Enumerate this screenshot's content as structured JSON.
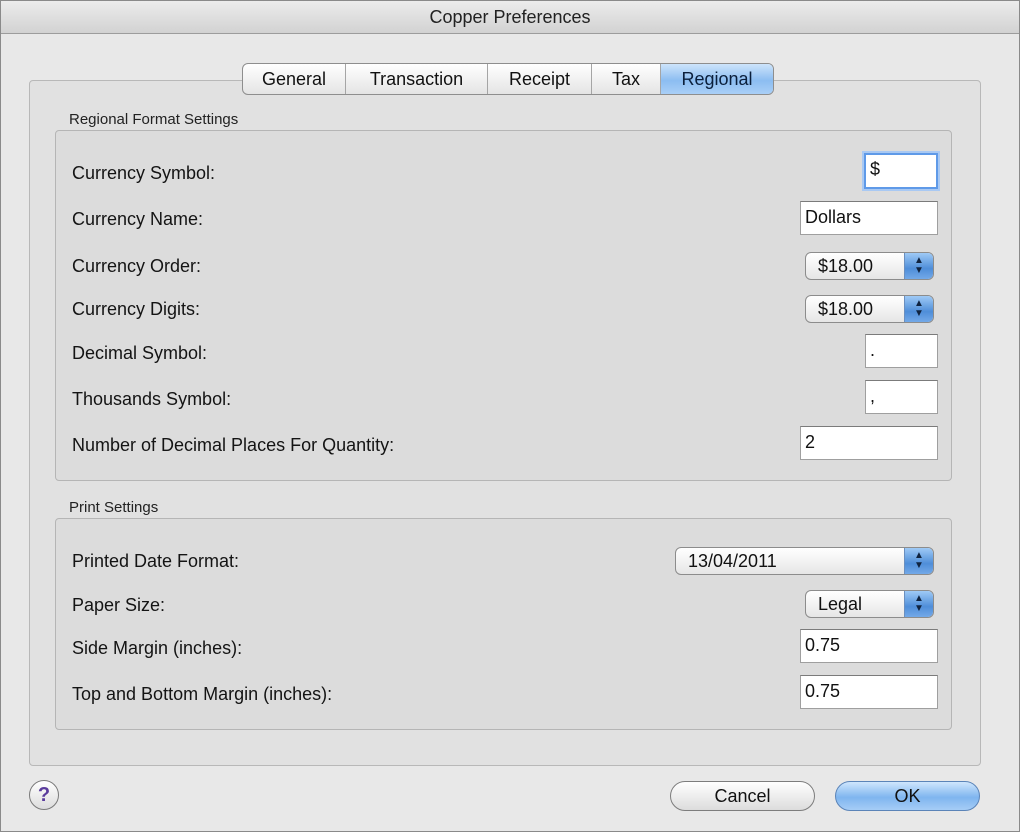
{
  "window": {
    "title": "Copper Preferences"
  },
  "tabs": [
    {
      "label": "General",
      "active": false
    },
    {
      "label": "Transaction",
      "active": false
    },
    {
      "label": "Receipt",
      "active": false
    },
    {
      "label": "Tax",
      "active": false
    },
    {
      "label": "Regional",
      "active": true
    }
  ],
  "regional": {
    "title": "Regional Format Settings",
    "currency_symbol": {
      "label": "Currency Symbol:",
      "value": "$"
    },
    "currency_name": {
      "label": "Currency Name:",
      "value": "Dollars"
    },
    "currency_order": {
      "label": "Currency Order:",
      "value": "$18.00"
    },
    "currency_digits": {
      "label": "Currency Digits:",
      "value": "$18.00"
    },
    "decimal_symbol": {
      "label": "Decimal Symbol:",
      "value": "."
    },
    "thousands_symbol": {
      "label": "Thousands Symbol:",
      "value": ","
    },
    "decimal_places": {
      "label": "Number of Decimal Places For Quantity:",
      "value": "2"
    }
  },
  "print": {
    "title": "Print Settings",
    "date_format": {
      "label": "Printed Date Format:",
      "value": "13/04/2011"
    },
    "paper_size": {
      "label": "Paper Size:",
      "value": "Legal"
    },
    "side_margin": {
      "label": "Side Margin (inches):",
      "value": "0.75"
    },
    "tb_margin": {
      "label": "Top and Bottom Margin (inches):",
      "value": "0.75"
    }
  },
  "buttons": {
    "help": "?",
    "cancel": "Cancel",
    "ok": "OK"
  },
  "icons": {
    "help": "help-icon",
    "popup_arrows": "updown-arrows-icon"
  },
  "colors": {
    "accent": "#7fb5ef",
    "focus_ring": "#5f9ae8"
  }
}
